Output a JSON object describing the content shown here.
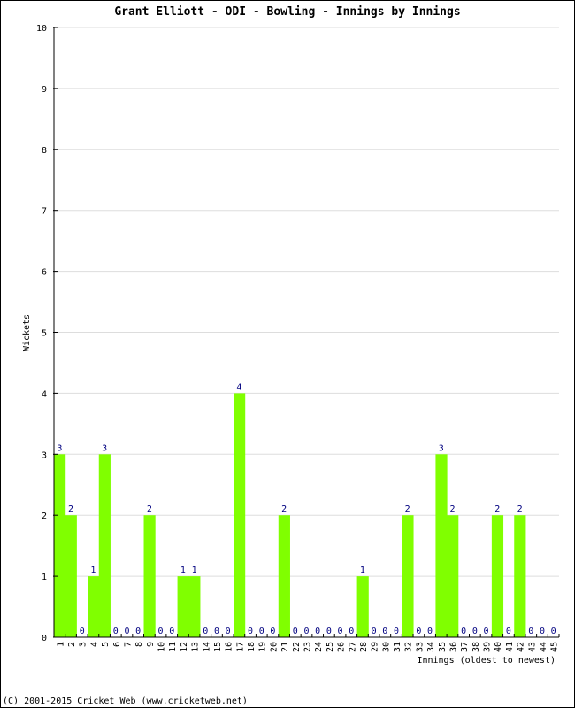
{
  "footer": "(C) 2001-2015 Cricket Web (www.cricketweb.net)",
  "colors": {
    "bar": "#80ff00",
    "label": "#000080",
    "grid": "#dddddd",
    "axis": "#000000"
  },
  "chart_data": {
    "type": "bar",
    "title": "Grant Elliott - ODI - Bowling - Innings by Innings",
    "xlabel": "Innings (oldest to newest)",
    "ylabel": "Wickets",
    "ylim": [
      0,
      10
    ],
    "yticks": [
      0,
      1,
      2,
      3,
      4,
      5,
      6,
      7,
      8,
      9,
      10
    ],
    "grid": true,
    "legend": "none",
    "categories": [
      "1",
      "2",
      "3",
      "4",
      "5",
      "6",
      "7",
      "8",
      "9",
      "10",
      "11",
      "12",
      "13",
      "14",
      "15",
      "16",
      "17",
      "18",
      "19",
      "20",
      "21",
      "22",
      "23",
      "24",
      "25",
      "26",
      "27",
      "28",
      "29",
      "30",
      "31",
      "32",
      "33",
      "34",
      "35",
      "36",
      "37",
      "38",
      "39",
      "40",
      "41",
      "42",
      "43",
      "44",
      "45"
    ],
    "values": [
      3,
      2,
      0,
      1,
      3,
      0,
      0,
      0,
      2,
      0,
      0,
      1,
      1,
      0,
      0,
      0,
      4,
      0,
      0,
      0,
      2,
      0,
      0,
      0,
      0,
      0,
      0,
      1,
      0,
      0,
      0,
      2,
      0,
      0,
      3,
      2,
      0,
      0,
      0,
      2,
      0,
      2,
      0,
      0,
      0
    ]
  }
}
